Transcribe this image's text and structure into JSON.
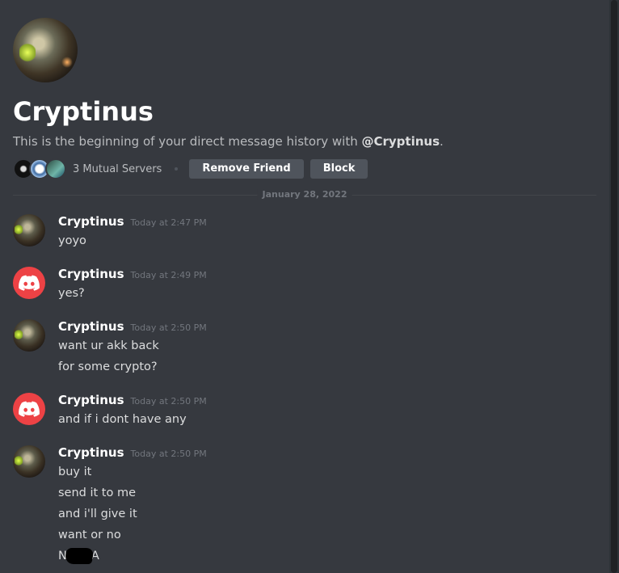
{
  "intro": {
    "name": "Cryptinus",
    "description_prefix": "This is the beginning of your direct message history with ",
    "mention": "@Cryptinus",
    "description_suffix": ".",
    "mutual_servers": "3 Mutual Servers",
    "remove_friend": "Remove Friend",
    "block": "Block"
  },
  "divider": {
    "date": "January 28, 2022"
  },
  "messages": [
    {
      "author": "Cryptinus",
      "avatar": "user-avatar",
      "time": "Today at 2:47 PM",
      "lines": [
        "yoyo"
      ]
    },
    {
      "author": "Cryptinus",
      "avatar": "discord-logo-icon",
      "time": "Today at 2:49 PM",
      "lines": [
        "yes?"
      ]
    },
    {
      "author": "Cryptinus",
      "avatar": "user-avatar",
      "time": "Today at 2:50 PM",
      "lines": [
        "want ur akk back",
        "for some crypto?"
      ]
    },
    {
      "author": "Cryptinus",
      "avatar": "discord-logo-icon",
      "time": "Today at 2:50 PM",
      "lines": [
        "and if i dont have any"
      ]
    },
    {
      "author": "Cryptinus",
      "avatar": "user-avatar",
      "time": "Today at 2:50 PM",
      "lines": [
        "buy it",
        "send it to me",
        "and i'll give it",
        "want or no"
      ],
      "last_line_start": "N",
      "last_line_end": "A"
    }
  ],
  "colors": {
    "background": "#36393f",
    "discord_red": "#ed4245",
    "button": "#4f545c"
  }
}
